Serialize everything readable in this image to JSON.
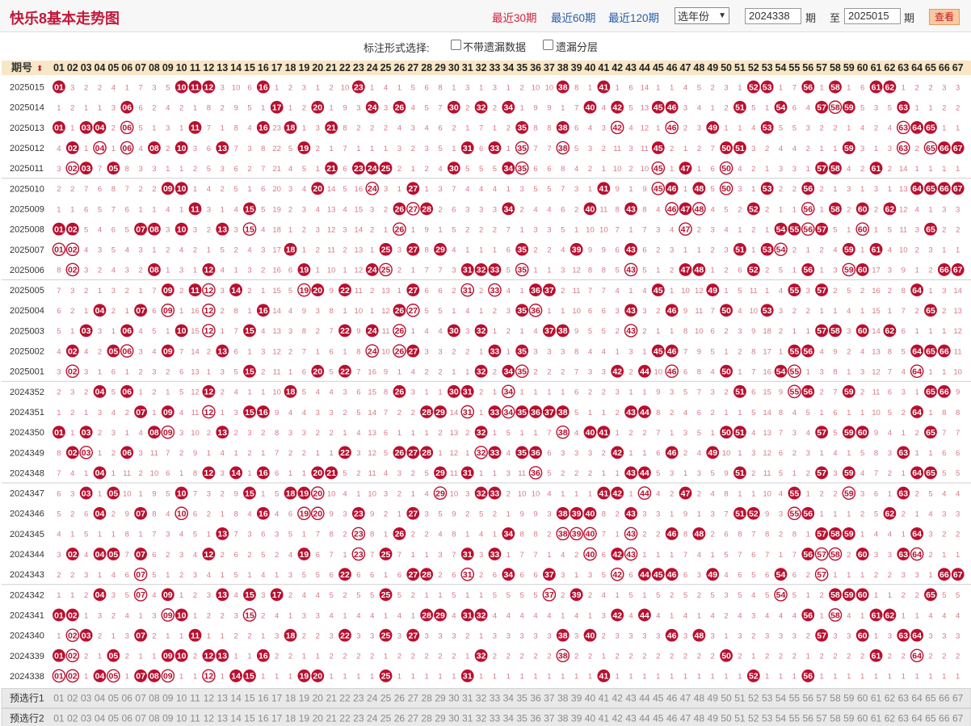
{
  "header": {
    "title": "快乐8基本走势图",
    "nav": [
      {
        "label": "最近30期",
        "active": true
      },
      {
        "label": "最近60期",
        "active": false
      },
      {
        "label": "最近120期",
        "active": false
      }
    ],
    "year_select": "选年份",
    "from_issue": "2024338",
    "issue_suffix": "期",
    "to_label": "至",
    "to_issue": "2025015",
    "view_button": "查看"
  },
  "options": {
    "label": "标注形式选择:",
    "no_miss": "不带遗漏数据",
    "miss_layer": "遗漏分层"
  },
  "table": {
    "col_header": "期号",
    "preselect_rows": [
      "预选行1",
      "预选行2"
    ],
    "columns": [
      "01",
      "02",
      "03",
      "04",
      "05",
      "06",
      "07",
      "08",
      "09",
      "10",
      "11",
      "12",
      "13",
      "14",
      "15",
      "16",
      "17",
      "18",
      "19",
      "20",
      "21",
      "22",
      "23",
      "24",
      "25",
      "26",
      "27",
      "28",
      "29",
      "30",
      "31",
      "32",
      "33",
      "34",
      "35",
      "36",
      "37",
      "38",
      "39",
      "40",
      "41",
      "42",
      "43",
      "44",
      "45",
      "46",
      "47",
      "48",
      "49",
      "50",
      "51",
      "52",
      "53",
      "54",
      "55",
      "56",
      "57",
      "58",
      "59",
      "60",
      "61",
      "62",
      "63",
      "64",
      "65",
      "66",
      "67"
    ],
    "rows": [
      {
        "issue": "2025015",
        "hits": [
          1,
          10,
          11,
          12,
          16,
          23,
          38,
          41,
          52,
          53,
          56,
          58,
          61,
          62
        ]
      },
      {
        "issue": "2025014",
        "hits": [
          6,
          17,
          20,
          24,
          26,
          30,
          32,
          34,
          40,
          42,
          45,
          46,
          51,
          54,
          57,
          58,
          59,
          63
        ]
      },
      {
        "issue": "2025013",
        "hits": [
          1,
          3,
          4,
          6,
          11,
          16,
          18,
          21,
          35,
          38,
          42,
          46,
          49,
          53,
          63,
          64,
          65
        ]
      },
      {
        "issue": "2025012",
        "hits": [
          2,
          4,
          6,
          8,
          10,
          13,
          19,
          31,
          33,
          35,
          38,
          45,
          50,
          51,
          59,
          63,
          65,
          66,
          67
        ]
      },
      {
        "issue": "2025011",
        "hits": [
          2,
          3,
          5,
          21,
          23,
          24,
          25,
          30,
          34,
          35,
          45,
          47,
          50,
          57,
          58,
          61
        ]
      },
      {
        "issue": "2025010",
        "hits": [
          9,
          10,
          20,
          24,
          27,
          41,
          45,
          46,
          48,
          50,
          53,
          56,
          64,
          65,
          66,
          67
        ]
      },
      {
        "issue": "2025009",
        "hits": [
          11,
          15,
          26,
          27,
          28,
          34,
          40,
          43,
          46,
          47,
          48,
          52,
          56,
          58,
          60,
          62
        ]
      },
      {
        "issue": "2025008",
        "hits": [
          1,
          2,
          7,
          8,
          10,
          13,
          15,
          26,
          47,
          54,
          55,
          56,
          57,
          60,
          65
        ]
      },
      {
        "issue": "2025007",
        "hits": [
          1,
          2,
          18,
          25,
          27,
          29,
          35,
          39,
          43,
          51,
          53,
          54,
          59,
          61
        ]
      },
      {
        "issue": "2025006",
        "hits": [
          2,
          8,
          12,
          19,
          24,
          25,
          31,
          32,
          33,
          35,
          43,
          47,
          48,
          52,
          56,
          59,
          60,
          66,
          67
        ]
      },
      {
        "issue": "2025005",
        "hits": [
          9,
          11,
          12,
          14,
          19,
          20,
          22,
          27,
          31,
          33,
          36,
          37,
          45,
          49,
          55,
          57,
          64
        ]
      },
      {
        "issue": "2025004",
        "hits": [
          4,
          7,
          9,
          12,
          16,
          26,
          27,
          35,
          36,
          43,
          46,
          50,
          53,
          65
        ]
      },
      {
        "issue": "2025003",
        "hits": [
          3,
          6,
          10,
          12,
          15,
          22,
          24,
          26,
          30,
          32,
          37,
          38,
          43,
          57,
          58,
          60,
          62
        ]
      },
      {
        "issue": "2025002",
        "hits": [
          2,
          5,
          6,
          9,
          13,
          24,
          26,
          27,
          33,
          35,
          45,
          46,
          55,
          56,
          64,
          65,
          66
        ]
      },
      {
        "issue": "2025001",
        "hits": [
          2,
          15,
          20,
          22,
          32,
          34,
          35,
          42,
          44,
          46,
          50,
          54,
          55,
          64
        ]
      },
      {
        "issue": "2024352",
        "hits": [
          4,
          6,
          12,
          18,
          26,
          30,
          31,
          34,
          51,
          55,
          56,
          59,
          65,
          66
        ]
      },
      {
        "issue": "2024351",
        "hits": [
          7,
          9,
          12,
          15,
          16,
          28,
          29,
          31,
          33,
          34,
          35,
          36,
          37,
          38,
          43,
          44,
          64
        ]
      },
      {
        "issue": "2024350",
        "hits": [
          1,
          3,
          8,
          9,
          13,
          32,
          38,
          40,
          41,
          50,
          51,
          57,
          59,
          60,
          65
        ]
      },
      {
        "issue": "2024349",
        "hits": [
          2,
          3,
          6,
          22,
          26,
          27,
          28,
          32,
          33,
          35,
          36,
          42,
          46,
          49,
          63
        ]
      },
      {
        "issue": "2024348",
        "hits": [
          4,
          12,
          14,
          16,
          20,
          21,
          29,
          31,
          36,
          43,
          44,
          51,
          57,
          59,
          64,
          65
        ]
      },
      {
        "issue": "2024347",
        "hits": [
          3,
          5,
          10,
          15,
          18,
          19,
          20,
          29,
          32,
          33,
          41,
          42,
          44,
          47,
          55,
          59,
          63
        ]
      },
      {
        "issue": "2024346",
        "hits": [
          4,
          7,
          10,
          16,
          19,
          20,
          23,
          27,
          38,
          39,
          40,
          43,
          51,
          52,
          55,
          56,
          62
        ]
      },
      {
        "issue": "2024345",
        "hits": [
          13,
          23,
          26,
          34,
          38,
          39,
          40,
          43,
          46,
          48,
          57,
          58,
          59,
          64
        ]
      },
      {
        "issue": "2024344",
        "hits": [
          2,
          4,
          5,
          7,
          12,
          19,
          23,
          25,
          31,
          33,
          40,
          42,
          43,
          56,
          57,
          58,
          60,
          63,
          64
        ]
      },
      {
        "issue": "2024343",
        "hits": [
          7,
          22,
          27,
          28,
          31,
          34,
          37,
          42,
          44,
          45,
          46,
          49,
          54,
          57,
          66,
          67
        ]
      },
      {
        "issue": "2024342",
        "hits": [
          4,
          7,
          9,
          13,
          15,
          17,
          25,
          37,
          39,
          54,
          58,
          59,
          60,
          65
        ]
      },
      {
        "issue": "2024341",
        "hits": [
          1,
          2,
          9,
          10,
          15,
          28,
          29,
          31,
          32,
          42,
          44,
          56,
          58,
          61,
          62
        ]
      },
      {
        "issue": "2024340",
        "hits": [
          2,
          3,
          7,
          11,
          18,
          22,
          25,
          27,
          38,
          40,
          46,
          48,
          57,
          60,
          63,
          64
        ]
      },
      {
        "issue": "2024339",
        "hits": [
          1,
          2,
          5,
          9,
          10,
          12,
          13,
          16,
          32,
          38,
          50,
          61,
          64
        ]
      },
      {
        "issue": "2024338",
        "hits": [
          1,
          2,
          4,
          5,
          7,
          8,
          9,
          12,
          14,
          15,
          19,
          20,
          25,
          31,
          41,
          52,
          56
        ]
      }
    ]
  },
  "colors": {
    "title": "#c3183a",
    "ball_fill": "#b8102f",
    "ball_ring": "#b8102f",
    "miss_text": "#d77a86",
    "header_bg": "#f7e7c6",
    "preselect_bg": "#e9e9e9"
  }
}
